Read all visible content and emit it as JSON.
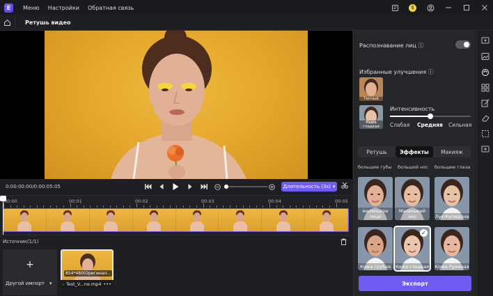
{
  "titlebar": {
    "menu": [
      "Меню",
      "Настройки",
      "Обратная связь"
    ]
  },
  "subheader": {
    "title": "Ретушь видео"
  },
  "player": {
    "timecode": "0:00:00:00/0:00:05:05",
    "duration_button": "Длительность (3s)"
  },
  "timeline": {
    "ticks": [
      "00:00",
      "00:01",
      "00:02",
      "00:03",
      "00:04",
      "00:05"
    ]
  },
  "source": {
    "label": "Источник(1/1)",
    "import_label": "Другой импорт",
    "media_info": "854*480(Оригинал...",
    "media_name": "Test_V...ne.mp4"
  },
  "panel": {
    "face_recognition": "Распознавание лиц",
    "favorites": "Избранные улучшения",
    "fav1": "Теплый",
    "fav2": "Кожа гладкая",
    "intensity": "Интенсивность",
    "intensity_value": 0.5,
    "intensity_levels": [
      "Слабая",
      "Средняя",
      "Сильная"
    ],
    "tabs": [
      "Ретушь",
      "Эффекты",
      "Макияж"
    ],
    "active_tab": 1,
    "column_headers": [
      "большие губы",
      "большой нос",
      "большие глаза"
    ],
    "effects": [
      "маленькое лицо",
      "Маленький нос",
      "Лук Купидона",
      "Кожа грубая",
      "Кожа гладкая",
      "Кожа Румяная"
    ],
    "selected_effect": 4,
    "export": "Экспорт"
  },
  "colors": {
    "accent": "#6f5cf0",
    "background": "#1e1f22",
    "panel": "#25262a",
    "photo_bg": "#e2a52a"
  }
}
